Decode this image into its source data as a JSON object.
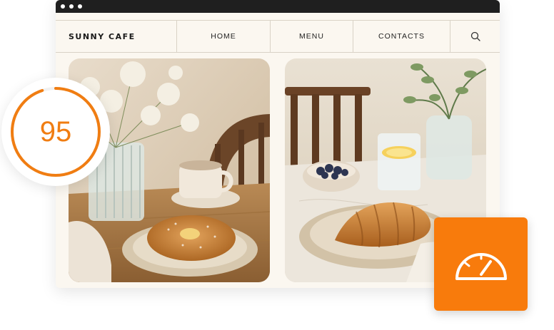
{
  "site": {
    "brand": "SUNNY CAFE",
    "nav": {
      "home": "HOME",
      "menu": "MENU",
      "contacts": "CONTACTS"
    },
    "search_icon": "search-icon"
  },
  "photos": [
    {
      "subject": "bagel with coffee cup and flower vase"
    },
    {
      "subject": "croissant with blueberries and lemon water"
    }
  ],
  "score": {
    "value": "95",
    "progress_fraction": 0.95,
    "accent_color": "#f07d12"
  },
  "badge": {
    "icon": "speedometer-icon",
    "color": "#f87b0c"
  }
}
